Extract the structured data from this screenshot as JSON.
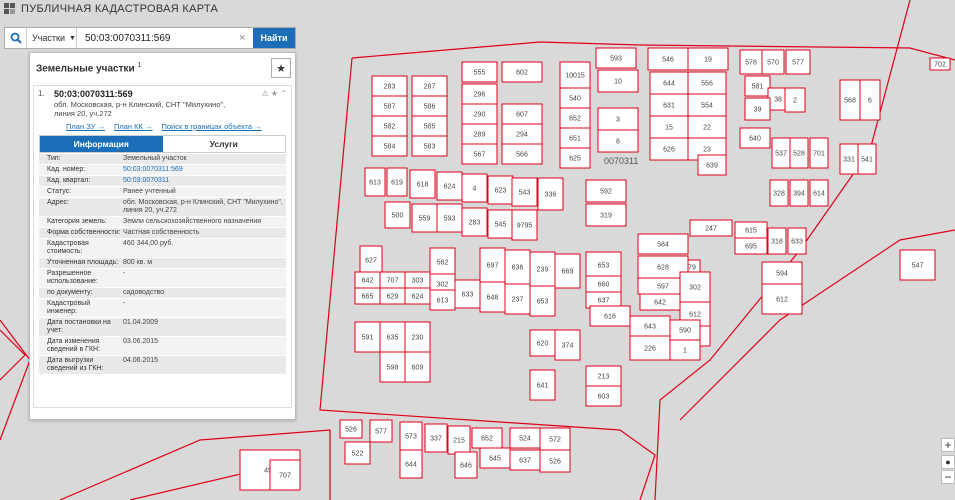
{
  "header": {
    "title": "ПУБЛИЧНАЯ КАДАСТРОВАЯ КАРТА"
  },
  "search": {
    "type_label": "Участки",
    "value": "50:03:0070311:569",
    "find_label": "Найти"
  },
  "panel": {
    "title": "Земельные участки",
    "count": "1",
    "item": {
      "number": "1.",
      "cad_number": "50:03:0070311:569",
      "address": "обл. Московская, р-н Клинский, СНТ \"Милухино\", линия 20, уч.272",
      "links": [
        "План ЗУ →",
        "План КК →",
        "Поиск в границах объекта →"
      ]
    },
    "tabs": [
      "Информация",
      "Услуги"
    ],
    "properties": [
      {
        "k": "Тип:",
        "v": "Земельный участок",
        "link": false
      },
      {
        "k": "Кад. номер:",
        "v": "50:03:0070311:569",
        "link": true
      },
      {
        "k": "Кад. квартал:",
        "v": "50:03:0070311",
        "link": true
      },
      {
        "k": "Статус:",
        "v": "Ранее учтенный",
        "link": false
      },
      {
        "k": "Адрес:",
        "v": "обл. Московская, р-н Клинский, СНТ \"Милухино\", линия 20, уч.272",
        "link": false
      },
      {
        "k": "Категория земель:",
        "v": "Земли сельскохозяйственного назначения",
        "link": false
      },
      {
        "k": "Форма собственности:",
        "v": "Частная собственность",
        "link": false
      },
      {
        "k": "Кадастровая стоимость:",
        "v": "460 344,00 руб.",
        "link": false
      },
      {
        "k": "Уточненная площадь:",
        "v": "800 кв. м",
        "link": false
      },
      {
        "k": "Разрешенное использование:",
        "v": "-",
        "link": false
      },
      {
        "k": "по документу:",
        "v": "садоводство",
        "link": false
      },
      {
        "k": "Кадастровый инженер:",
        "v": "-",
        "link": false
      },
      {
        "k": "Дата постановки на учет:",
        "v": "01.04.2009",
        "link": false
      },
      {
        "k": "Дата изменения сведений в ГКН:",
        "v": "03.06.2015",
        "link": false
      },
      {
        "k": "Дата выгрузки сведений из ГКН:",
        "v": "04.06.2015",
        "link": false
      }
    ]
  },
  "map": {
    "block_label": "0070311",
    "selected_parcel": "569",
    "parcels": [
      "555",
      "602",
      "10015",
      "593",
      "546",
      "19",
      "578",
      "570",
      "577",
      "702",
      "283",
      "287",
      "296",
      "540",
      "10",
      "644",
      "556",
      "581",
      "38",
      "568",
      "6",
      "587",
      "586",
      "290",
      "607",
      "652",
      "631",
      "554",
      "39",
      "2",
      "582",
      "585",
      "289",
      "294",
      "651",
      "3",
      "15",
      "22",
      "584",
      "583",
      "567",
      "566",
      "625",
      "8",
      "626",
      "23",
      "640",
      "537",
      "528",
      "701",
      "331",
      "541",
      "639",
      "613",
      "619",
      "618",
      "624",
      "4",
      "623",
      "543",
      "336",
      "592",
      "328",
      "394",
      "614",
      "500",
      "559",
      "593",
      "283",
      "545",
      "9795",
      "319",
      "247",
      "615",
      "318",
      "633",
      "695",
      "584",
      "379",
      "547",
      "627",
      "562",
      "697",
      "636",
      "239",
      "669",
      "653",
      "628",
      "642",
      "707",
      "303",
      "302",
      "633",
      "648",
      "237",
      "653",
      "660",
      "637",
      "597",
      "642",
      "302",
      "594",
      "665",
      "629",
      "624",
      "613",
      "612",
      "612",
      "616",
      "544",
      "591",
      "635",
      "230",
      "643",
      "590",
      "598",
      "609",
      "620",
      "374",
      "226",
      "1",
      "213",
      "641",
      "603",
      "526",
      "577",
      "573",
      "337",
      "215",
      "652",
      "524",
      "572",
      "522",
      "644",
      "646",
      "645",
      "637",
      "526",
      "492",
      "707"
    ],
    "zoom_in": "+",
    "zoom_out": "−"
  }
}
